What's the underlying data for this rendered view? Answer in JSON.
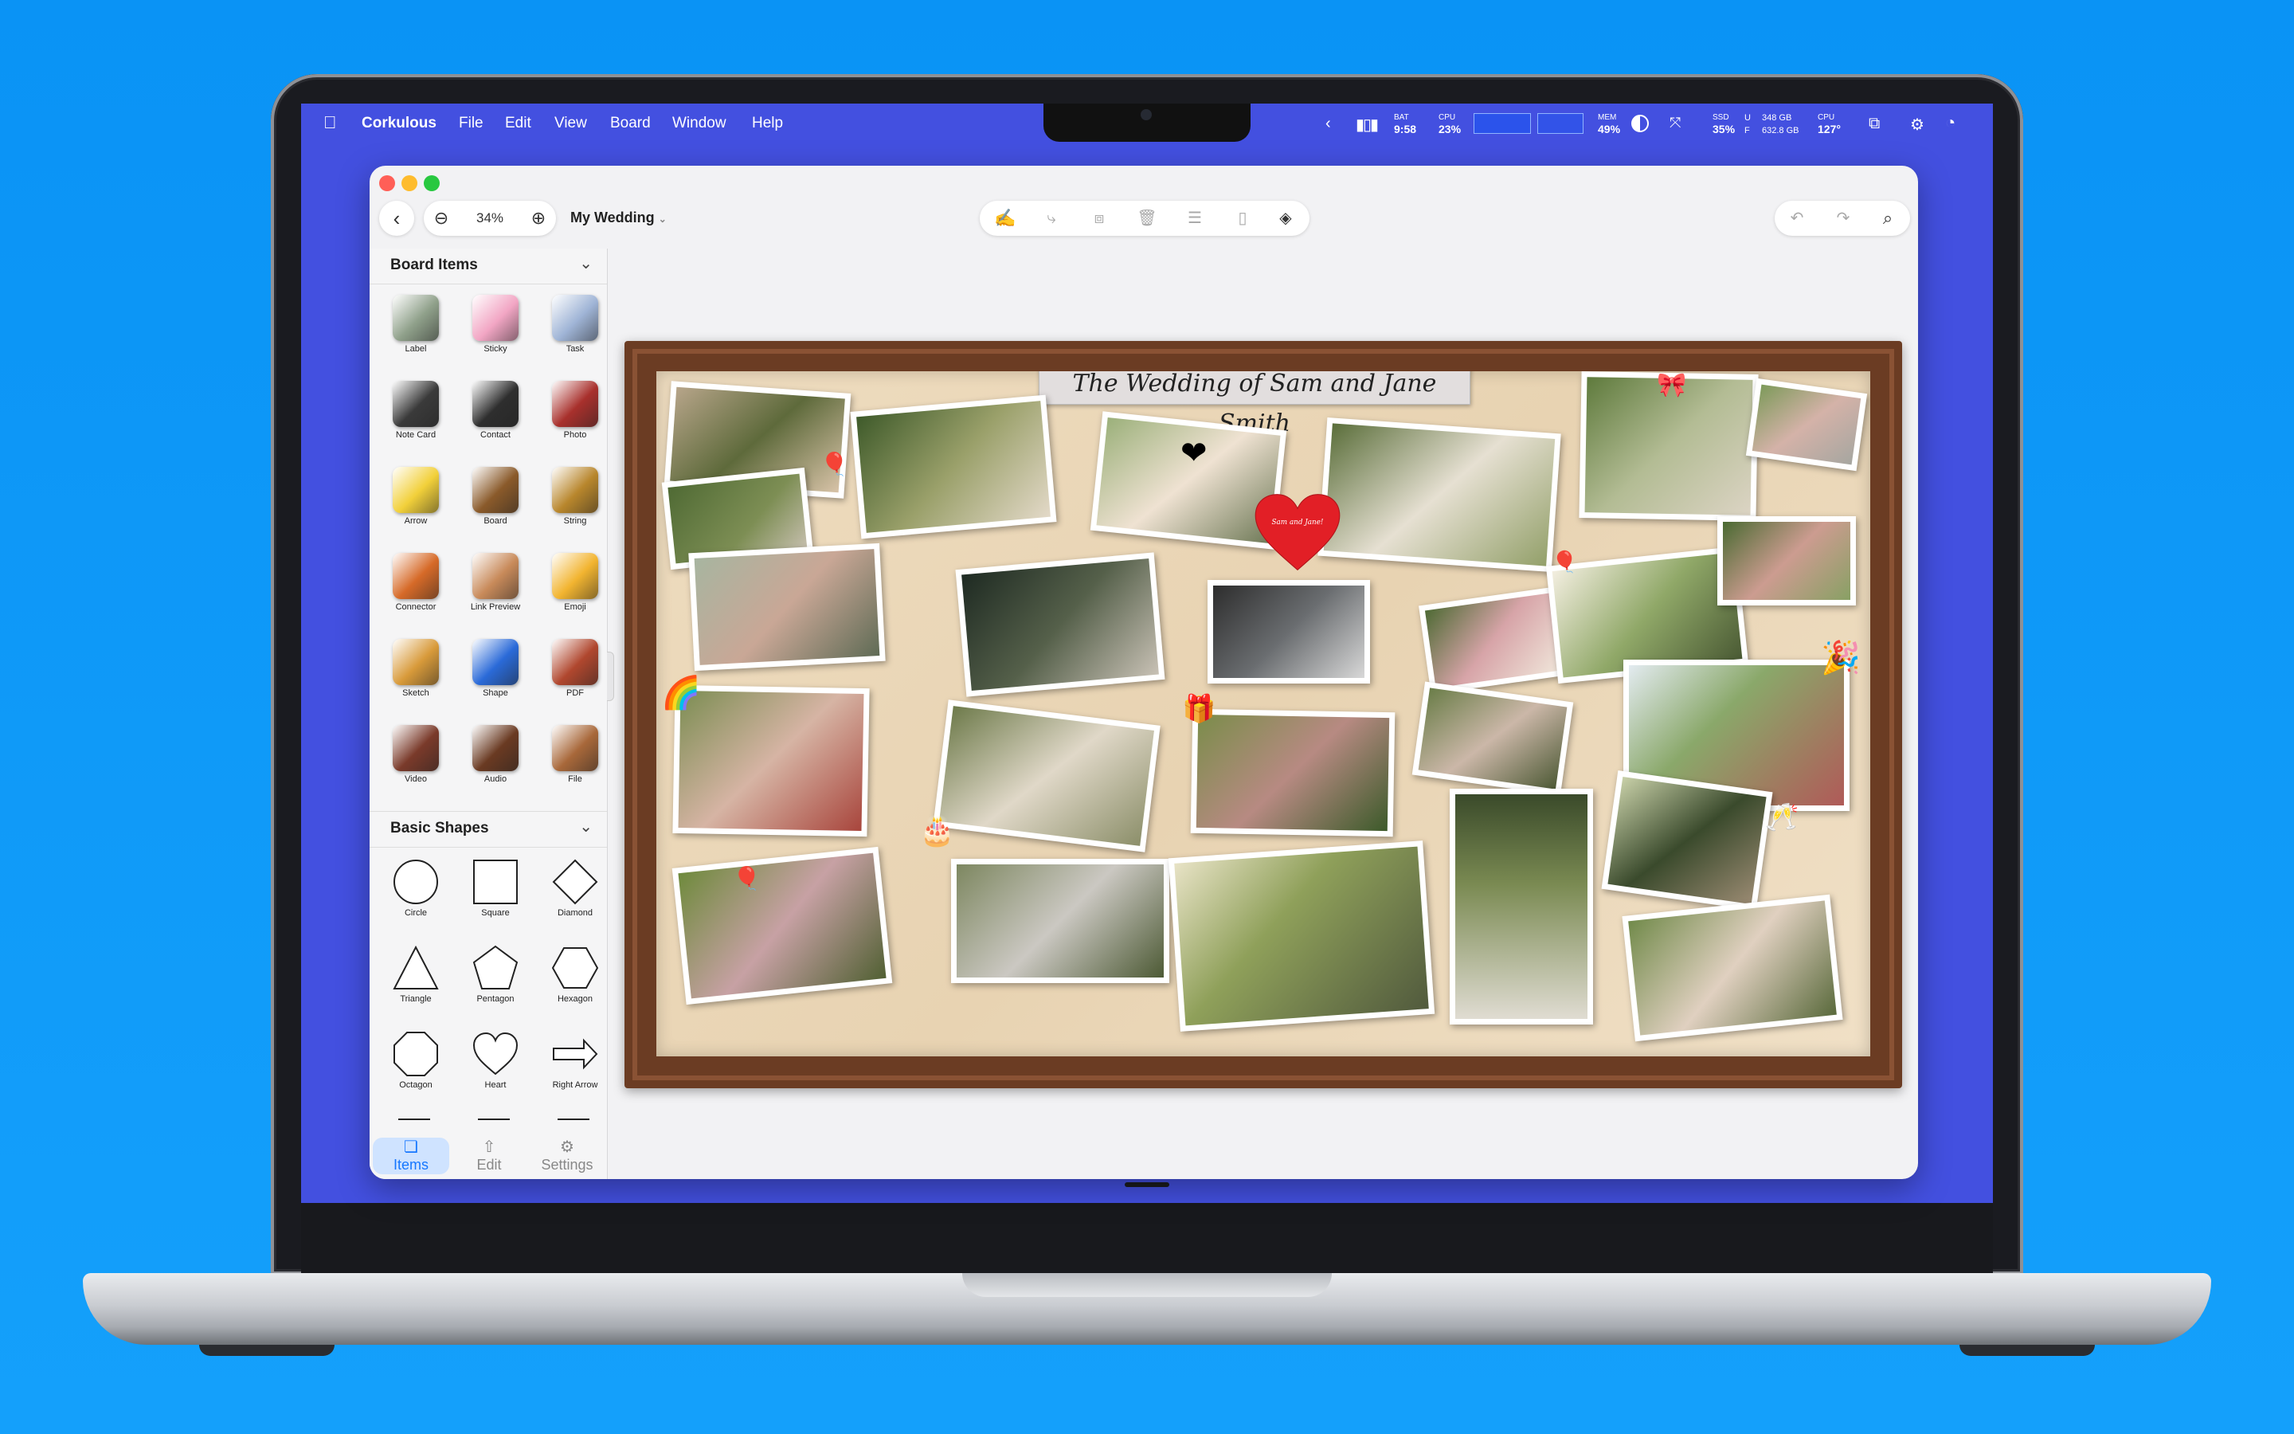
{
  "menubar": {
    "apple": "",
    "app_name": "Corkulous",
    "menus": [
      "File",
      "Edit",
      "View",
      "Board",
      "Window",
      "Help"
    ],
    "bat_label": "BAT",
    "bat_value": "9:58",
    "cpu_label": "CPU",
    "cpu_value": "23%",
    "mem_label": "MEM",
    "mem_value": "49%",
    "ssd_label": "SSD",
    "ssd_value": "35%",
    "ssd_u_label": "U",
    "ssd_u_value": "348 GB",
    "ssd_f_label": "F",
    "ssd_f_value": "632.8 GB",
    "cpu_temp_label": "CPU",
    "cpu_temp_value": "127°"
  },
  "toolbar": {
    "zoom": "34%",
    "board_name": "My Wedding"
  },
  "sidebar": {
    "board_items_title": "Board Items",
    "board_items": [
      {
        "label": "Label",
        "icon": "label-icon",
        "color": "#8fa08a"
      },
      {
        "label": "Sticky",
        "icon": "sticky-icon",
        "color": "#f2a6c4"
      },
      {
        "label": "Task",
        "icon": "task-icon",
        "color": "#9fb4d6"
      },
      {
        "label": "Note Card",
        "icon": "note-card-icon",
        "color": "#3a3a3a"
      },
      {
        "label": "Contact",
        "icon": "contact-icon",
        "color": "#2e2e2e"
      },
      {
        "label": "Photo",
        "icon": "photo-icon",
        "color": "#a8302c"
      },
      {
        "label": "Arrow",
        "icon": "arrow-pin-icon",
        "color": "#f2d03a"
      },
      {
        "label": "Board",
        "icon": "board-icon",
        "color": "#8a5a2a"
      },
      {
        "label": "String",
        "icon": "string-icon",
        "color": "#b8862c"
      },
      {
        "label": "Connector",
        "icon": "connector-icon",
        "color": "#d66a28"
      },
      {
        "label": "Link Preview",
        "icon": "link-preview-icon",
        "color": "#c88a5a"
      },
      {
        "label": "Emoji",
        "icon": "emoji-icon",
        "color": "#f2b430"
      },
      {
        "label": "Sketch",
        "icon": "sketch-icon",
        "color": "#d89a3a"
      },
      {
        "label": "Shape",
        "icon": "shape-icon",
        "color": "#2a6ad8"
      },
      {
        "label": "PDF",
        "icon": "pdf-icon",
        "color": "#b0472e"
      },
      {
        "label": "Video",
        "icon": "video-icon",
        "color": "#7a3a2a"
      },
      {
        "label": "Audio",
        "icon": "audio-icon",
        "color": "#6a3a22"
      },
      {
        "label": "File",
        "icon": "file-icon",
        "color": "#a8683a"
      }
    ],
    "basic_shapes_title": "Basic Shapes",
    "basic_shapes": [
      {
        "label": "Circle",
        "icon": "circle-shape-icon"
      },
      {
        "label": "Square",
        "icon": "square-shape-icon"
      },
      {
        "label": "Diamond",
        "icon": "diamond-shape-icon"
      },
      {
        "label": "Triangle",
        "icon": "triangle-shape-icon"
      },
      {
        "label": "Pentagon",
        "icon": "pentagon-shape-icon"
      },
      {
        "label": "Hexagon",
        "icon": "hexagon-shape-icon"
      },
      {
        "label": "Octagon",
        "icon": "octagon-shape-icon"
      },
      {
        "label": "Heart",
        "icon": "heart-shape-icon"
      },
      {
        "label": "Right Arrow",
        "icon": "right-arrow-shape-icon"
      }
    ],
    "tabs": [
      {
        "label": "Items",
        "icon": "items-icon",
        "active": true
      },
      {
        "label": "Edit",
        "icon": "edit-icon",
        "active": false
      },
      {
        "label": "Settings",
        "icon": "settings-icon",
        "active": false
      }
    ]
  },
  "board": {
    "title": "The Wedding of Sam and Jane Smith",
    "heart_note": "Sam and Jane!",
    "colors": {
      "frame": "#6b3c23",
      "cork": "#e8d3b2",
      "heart": "#e21f26"
    }
  }
}
